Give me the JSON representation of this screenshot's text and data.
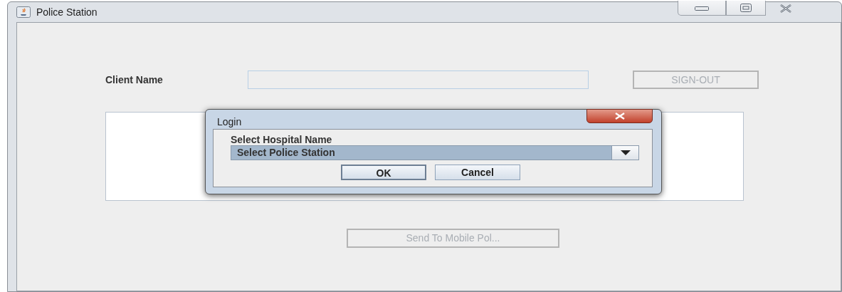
{
  "window": {
    "title": "Police Station"
  },
  "client_name": {
    "label": "Client Name"
  },
  "sign_out_button": {
    "label": "SIGN-OUT",
    "disabled": true
  },
  "send_button": {
    "label": "Send To Mobile Pol...",
    "disabled": true
  },
  "dialog": {
    "title": "Login",
    "prompt": "Select Hospital Name",
    "combo": {
      "value": "Select Police Station"
    },
    "buttons": [
      {
        "label": "OK",
        "selected": true
      },
      {
        "label": "Cancel",
        "selected": false
      }
    ]
  }
}
